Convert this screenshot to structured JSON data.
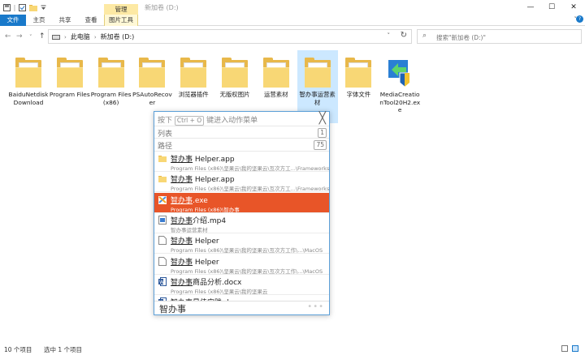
{
  "window": {
    "title": "新加卷 (D:)",
    "minimize": "—",
    "maximize": "☐",
    "close": "✕"
  },
  "quick_access": {
    "items": [
      "save-icon",
      "checkbox-icon",
      "folder-icon",
      "dropdown-icon"
    ],
    "separator": "|"
  },
  "context_tab": "管理",
  "ribbon": {
    "tabs": [
      "文件",
      "主页",
      "共享",
      "查看",
      "图片工具"
    ],
    "collapse": "˅",
    "help": "?"
  },
  "nav": {
    "back": "←",
    "forward": "→",
    "recent": "˅",
    "up": "↑"
  },
  "address": {
    "crumbs": [
      "此电脑",
      "新加卷 (D:)"
    ],
    "separator": "›",
    "dropdown": "˅",
    "refresh": "↻"
  },
  "search": {
    "icon": "⌕",
    "placeholder": "搜索\"新加卷 (D:)\""
  },
  "files": [
    {
      "label": "BaiduNetdiskDownload",
      "kind": "folder",
      "selected": false
    },
    {
      "label": "Program Files",
      "kind": "folder",
      "selected": false
    },
    {
      "label": "Program Files (x86)",
      "kind": "folder",
      "selected": false
    },
    {
      "label": "PSAutoRecover",
      "kind": "folder",
      "selected": false
    },
    {
      "label": "浏览器插件",
      "kind": "folder",
      "selected": false
    },
    {
      "label": "无版权图片",
      "kind": "folder",
      "selected": false
    },
    {
      "label": "运营素材",
      "kind": "folder",
      "selected": false
    },
    {
      "label": "智办事运营素材",
      "kind": "folder",
      "selected": true
    },
    {
      "label": "字体文件",
      "kind": "folder",
      "selected": false
    },
    {
      "label": "MediaCreationTool20H2.exe",
      "kind": "exe",
      "selected": false
    }
  ],
  "status": {
    "count": "10 个项目",
    "selection": "选中 1 个项目"
  },
  "launcher": {
    "hint_pre": "按下",
    "hint_key": "Ctrl + O",
    "hint_post": "键进入动作菜单",
    "close": "╳",
    "list_label": "列表",
    "list_badge": "1",
    "path_label": "路径",
    "path_badge": "75",
    "query": "智办事",
    "more": "•••",
    "results": [
      {
        "name_hl": "智办事",
        "name_rest": " Helper.app",
        "path": "Program Files (x86)\\坚果云\\我的坚果云\\互次方工...\\Frameworks",
        "icon": "folder",
        "active": false
      },
      {
        "name_hl": "智办事",
        "name_rest": " Helper.app",
        "path": "Program Files (x86)\\坚果云\\我的坚果云\\互次方工...\\Frameworks",
        "icon": "folder",
        "active": false
      },
      {
        "name_hl": "智办事",
        "name_rest": ".exe",
        "path": "Program Files (x86)\\智办事",
        "icon": "exe",
        "active": true
      },
      {
        "name_hl": "智办事",
        "name_rest": "介绍.mp4",
        "path": "智办事运营素材",
        "icon": "video",
        "active": false
      },
      {
        "name_hl": "智办事",
        "name_rest": " Helper",
        "path": "Program Files (x86)\\坚果云\\我的坚果云\\互次方工作\\...\\MacOS",
        "icon": "file",
        "active": false
      },
      {
        "name_hl": "智办事",
        "name_rest": " Helper",
        "path": "Program Files (x86)\\坚果云\\我的坚果云\\互次方工作\\...\\MacOS",
        "icon": "file",
        "active": false
      },
      {
        "name_hl": "智办事",
        "name_rest": "商品分析.docx",
        "path": "Program Files (x86)\\坚果云\\我的坚果云",
        "icon": "word",
        "active": false
      },
      {
        "name_hl": "智办事",
        "name_rest": "最佳实践.docx",
        "path": "",
        "icon": "word",
        "active": false
      }
    ]
  }
}
